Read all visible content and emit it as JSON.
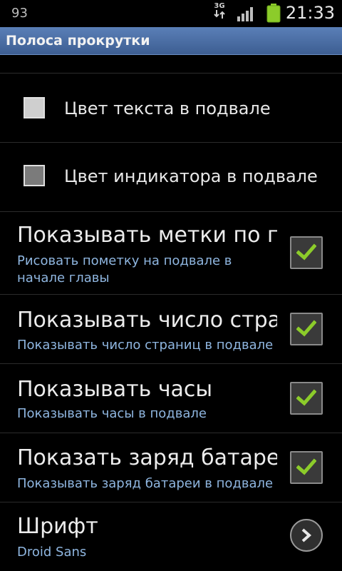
{
  "status_bar": {
    "notification_count": "93",
    "network_label": "3G",
    "time": "21:33",
    "signal_icon": "signal-icon",
    "battery_icon": "battery-icon",
    "battery_color": "#8ccc2a"
  },
  "title_bar": {
    "title": "Полоса прокрутки"
  },
  "settings": {
    "footer_text_color": {
      "label": "Цвет текста в подвале"
    },
    "footer_indicator_color": {
      "label": "Цвет индикатора в подвале"
    },
    "chapter_marks": {
      "title": "Показывать метки по главам",
      "subtitle": "Рисовать пометку на подвале в начале главы",
      "checked": true
    },
    "page_count": {
      "title": "Показывать число страниц",
      "subtitle": "Показывать число страниц в подвале",
      "checked": true
    },
    "clock": {
      "title": "Показывать часы",
      "subtitle": "Показывать часы в подвале",
      "checked": true
    },
    "battery": {
      "title": "Показать заряд батареи",
      "subtitle": "Показывать заряд батареи в подвале",
      "checked": true
    },
    "font": {
      "title": "Шрифт",
      "subtitle": "Droid Sans"
    }
  },
  "colors": {
    "accent_check": "#8ccc2a",
    "subtitle": "#8fb6e0",
    "title_bar": "#4a6da4"
  }
}
